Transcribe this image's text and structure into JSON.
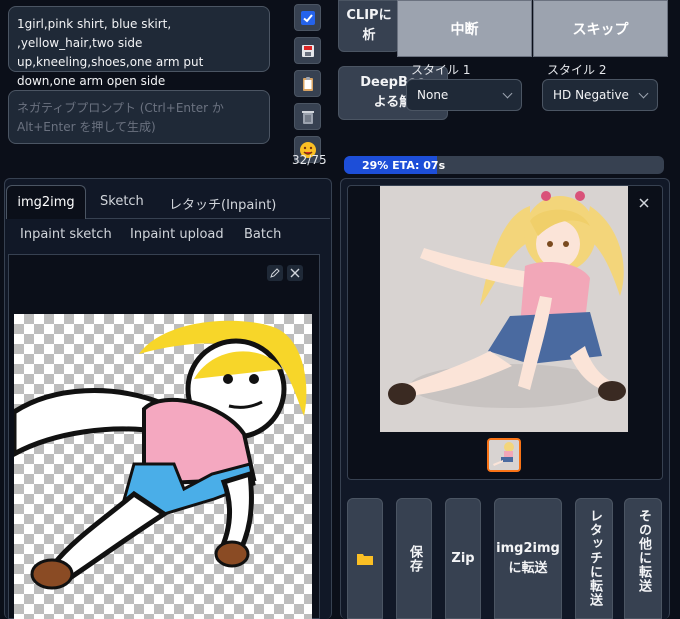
{
  "prompt": {
    "positive": "1girl,pink shirt, blue skirt, ,yellow_hair,two side up,kneeling,shoes,one arm put down,one arm open side",
    "negative_placeholder": "ネガティブプロンプト (Ctrl+Enter か Alt+Enter を押して生成)",
    "token_count": "32/75"
  },
  "tools": {
    "icons": [
      "checkbox-icon",
      "save-icon",
      "clipboard-icon",
      "trash-icon",
      "emoji-icon"
    ]
  },
  "interrogate": {
    "clip_label": "CLIPに\n析",
    "deepbooru_label": "DeepBoo\nよる解"
  },
  "controls": {
    "interrupt": "中断",
    "skip": "スキップ"
  },
  "styles": {
    "style1_label": "スタイル 1",
    "style1_value": "None",
    "style2_label": "スタイル 2",
    "style2_value": "HD Negative"
  },
  "progress": {
    "text": "29% ETA: 07s",
    "fraction": 0.29
  },
  "tabs": {
    "row1": [
      "img2img",
      "Sketch",
      "レタッチ(Inpaint)"
    ],
    "row2": [
      "Inpaint sketch",
      "Inpaint upload",
      "Batch"
    ]
  },
  "output_buttons": {
    "folder": "folder-icon",
    "save": "保存",
    "zip": "Zip",
    "to_img2img": "img2img\nに転送",
    "to_inpaint": "レタッチに転送",
    "to_other": "その他に転送"
  },
  "colors": {
    "accent": "#1d4ed8",
    "background": "#0b0f19",
    "button": "#374151",
    "hair": "#f7d629",
    "shirt": "#f4a8c0",
    "skirt": "#4aaee8"
  }
}
